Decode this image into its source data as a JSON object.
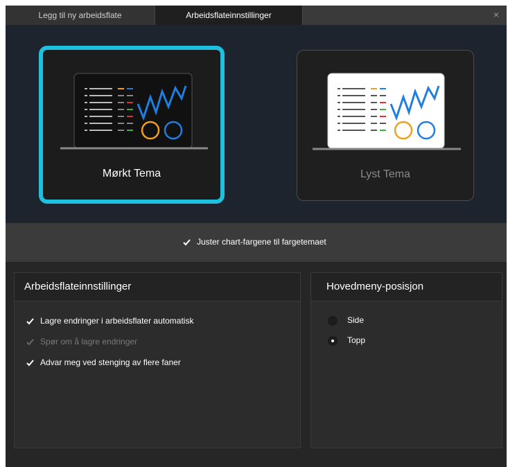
{
  "tabs": [
    {
      "label": "Legg til ny arbeidsflate"
    },
    {
      "label": "Arbeidsflateinnstillinger"
    }
  ],
  "close_glyph": "×",
  "themes": {
    "dark": {
      "label": "Mørkt Tema",
      "selected": true
    },
    "light": {
      "label": "Lyst Tema",
      "selected": false
    }
  },
  "adjust_chart_colors": {
    "label": "Juster chart-fargene til fargetemaet",
    "checked": true
  },
  "workspace_settings": {
    "title": "Arbeidsflateinnstillinger",
    "options": [
      {
        "label": "Lagre endringer i arbeidsflater automatisk",
        "checked": true,
        "disabled": false
      },
      {
        "label": "Spør om å lagre endringer",
        "checked": true,
        "disabled": true
      },
      {
        "label": "Advar meg ved stenging av flere faner",
        "checked": true,
        "disabled": false
      }
    ]
  },
  "main_menu_position": {
    "title": "Hovedmeny-posisjon",
    "options": [
      {
        "label": "Side",
        "selected": false
      },
      {
        "label": "Topp",
        "selected": true
      }
    ]
  },
  "colors": {
    "accent": "#1ec0e0",
    "chart_blue": "#1e7fe0",
    "chart_orange": "#f0a020"
  }
}
